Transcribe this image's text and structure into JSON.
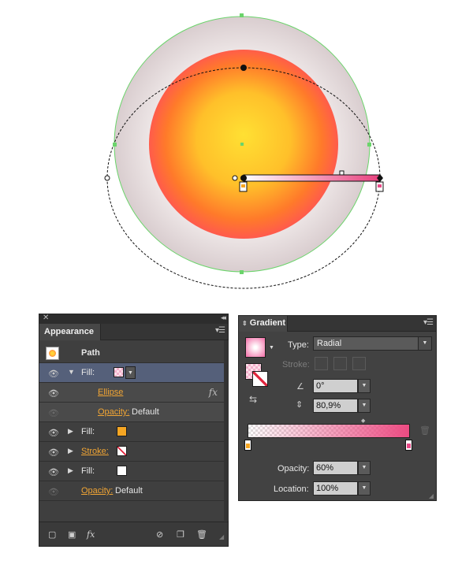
{
  "appearance": {
    "tab_label": "Appearance",
    "object_label": "Path",
    "rows": [
      {
        "label": "Fill:",
        "swatch_color": "#f2a0bf",
        "expanded": true
      },
      {
        "label": "Ellipse",
        "fx": "fx"
      },
      {
        "label": "Opacity:",
        "value": "Default"
      },
      {
        "label": "Fill:",
        "swatch_color": "#f5a623"
      },
      {
        "label": "Stroke:",
        "swatch_color": "#ffffff"
      },
      {
        "label": "Fill:",
        "swatch_color": "#ffffff"
      },
      {
        "label": "Opacity:",
        "value": "Default"
      }
    ],
    "bottom_fx": "fx"
  },
  "gradient": {
    "tab_label": "Gradient",
    "type_label": "Type:",
    "type_value": "Radial",
    "stroke_label": "Stroke:",
    "angle_value": "0°",
    "aspect_value": "80,9%",
    "opacity_label": "Opacity:",
    "opacity_value": "60%",
    "location_label": "Location:",
    "location_value": "100%",
    "stop_colors": [
      "#f5a623",
      "#e84a87"
    ]
  },
  "colors": {
    "panel_bg": "#3f3f3f",
    "selected_row": "#55607a",
    "accent_orange": "#f1a534",
    "selection_green": "#6bd46b"
  }
}
